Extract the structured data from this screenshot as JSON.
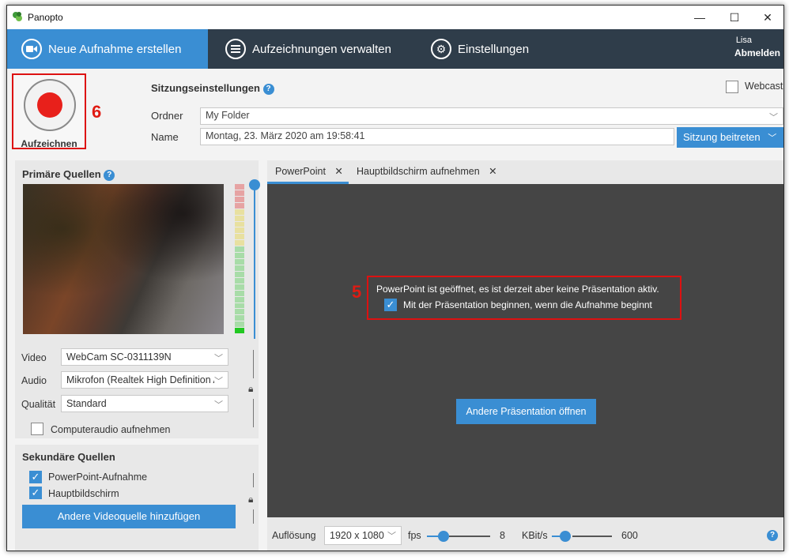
{
  "window": {
    "title": "Panopto"
  },
  "nav": {
    "new_recording": "Neue Aufnahme erstellen",
    "manage_recordings": "Aufzeichnungen verwalten",
    "settings": "Einstellungen",
    "user": "Lisa",
    "logout": "Abmelden"
  },
  "record": {
    "label": "Aufzeichnen",
    "marker": "6"
  },
  "session": {
    "title": "Sitzungseinstellungen",
    "folder_label": "Ordner",
    "folder_value": "My Folder",
    "name_label": "Name",
    "name_value": "Montag, 23. März 2020 am 19:58:41",
    "join_button": "Sitzung beitreten",
    "webcast_label": "Webcast"
  },
  "primary": {
    "title": "Primäre Quellen",
    "video_label": "Video",
    "video_value": "WebCam SC-0311139N",
    "audio_label": "Audio",
    "audio_value": "Mikrofon (Realtek High Definition A",
    "quality_label": "Qualität",
    "quality_value": "Standard",
    "computer_audio_label": "Computeraudio aufnehmen"
  },
  "secondary": {
    "title": "Sekundäre Quellen",
    "items": [
      "PowerPoint-Aufnahme",
      "Hauptbildschirm"
    ],
    "add_button": "Andere Videoquelle hinzufügen"
  },
  "preview": {
    "tabs": [
      "PowerPoint",
      "Hauptbildschirm aufnehmen"
    ],
    "marker": "5",
    "message": "PowerPoint ist geöffnet, es ist derzeit aber keine Präsentation aktiv.",
    "start_with_recording": "Mit der Präsentation beginnen, wenn die Aufnahme beginnt",
    "open_button": "Andere Präsentation öffnen"
  },
  "bottom": {
    "resolution_label": "Auflösung",
    "resolution_value": "1920 x 1080",
    "fps_label": "fps",
    "fps_value": "8",
    "kbits_label": "KBit/s",
    "kbits_value": "600"
  },
  "colors": {
    "accent": "#3a8ed3",
    "nav_bg": "#2f3d4a",
    "record_red": "#e8201b",
    "highlight": "#dd1111"
  }
}
